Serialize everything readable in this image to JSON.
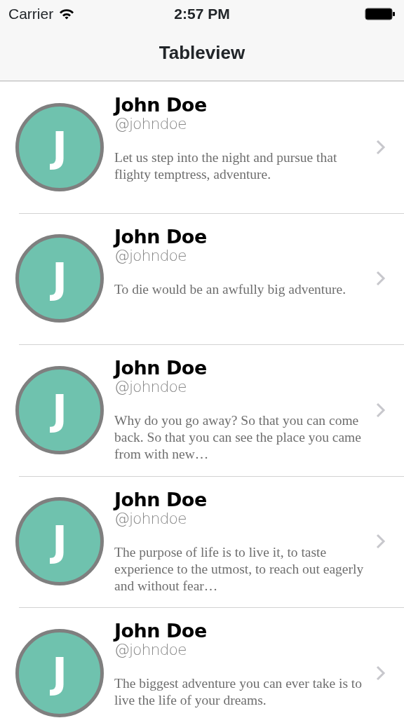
{
  "status_bar": {
    "carrier": "Carrier",
    "time": "2:57 PM"
  },
  "nav_bar": {
    "title": "Tableview"
  },
  "rows": [
    {
      "initial": "J",
      "name": "John Doe",
      "handle": "@johndoe",
      "quote": "Let us step into the night and pursue that flighty temptress, adventure."
    },
    {
      "initial": "J",
      "name": "John Doe",
      "handle": "@johndoe",
      "quote": "To die would be an awfully big adventure."
    },
    {
      "initial": "J",
      "name": "John Doe",
      "handle": "@johndoe",
      "quote": "Why do you go away? So that you can come back. So that you can see the place you came from with new…"
    },
    {
      "initial": "J",
      "name": "John Doe",
      "handle": "@johndoe",
      "quote": "The purpose of life is to live it, to taste experience to the utmost, to reach out eagerly and without fear…"
    },
    {
      "initial": "J",
      "name": "John Doe",
      "handle": "@johndoe",
      "quote": "The biggest adventure you can ever take is to live the life of your dreams."
    }
  ]
}
